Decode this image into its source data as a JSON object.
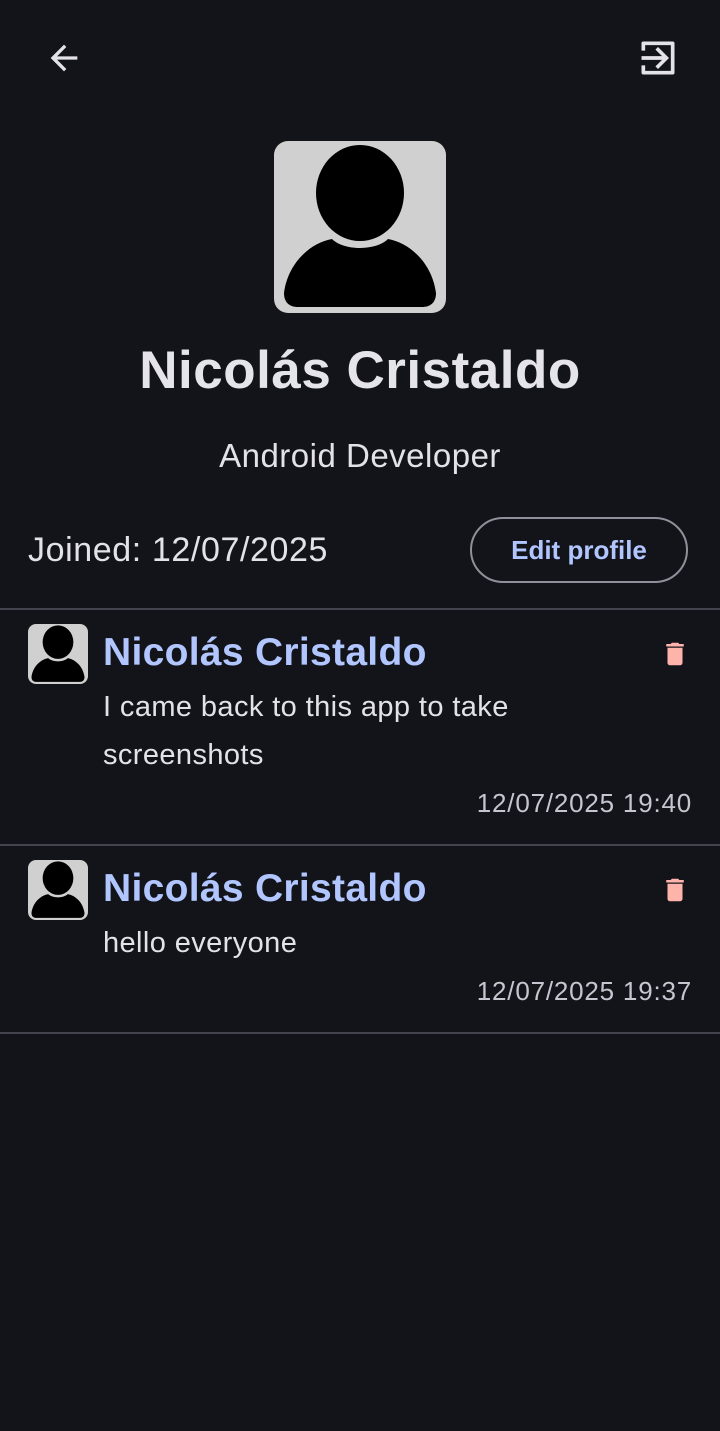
{
  "header": {
    "back_icon": "arrow-back-icon",
    "logout_icon": "logout-icon"
  },
  "profile": {
    "avatar_icon": "person-silhouette-icon",
    "name": "Nicolás Cristaldo",
    "role": "Android Developer",
    "joined": "Joined: 12/07/2025",
    "edit_button": "Edit profile"
  },
  "posts": [
    {
      "author": "Nicolás Cristaldo",
      "text": "I came back to this app to take screenshots",
      "timestamp": "12/07/2025 19:40",
      "delete_icon": "trash-icon"
    },
    {
      "author": "Nicolás Cristaldo",
      "text": "hello everyone",
      "timestamp": "12/07/2025 19:37",
      "delete_icon": "trash-icon"
    }
  ],
  "colors": {
    "background": "#13141a",
    "accent": "#b1c5ff",
    "delete": "#ffb4ab",
    "divider": "#43444d"
  }
}
